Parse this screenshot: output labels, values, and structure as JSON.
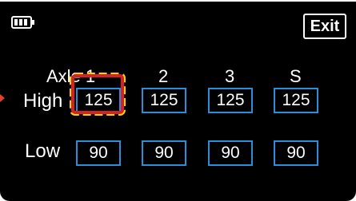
{
  "header": {
    "battery_icon": "battery-icon",
    "exit_label": "Exit"
  },
  "columns": [
    "Axle 1",
    "2",
    "3",
    "S"
  ],
  "rows": [
    {
      "label": "High",
      "values": [
        "125",
        "125",
        "125",
        "125"
      ]
    },
    {
      "label": "Low",
      "values": [
        "90",
        "90",
        "90",
        "90"
      ]
    }
  ],
  "colors": {
    "background": "#000000",
    "box_border": "#2a8fd8",
    "highlight_red": "#d8202a",
    "highlight_yellow": "#ffd400"
  }
}
